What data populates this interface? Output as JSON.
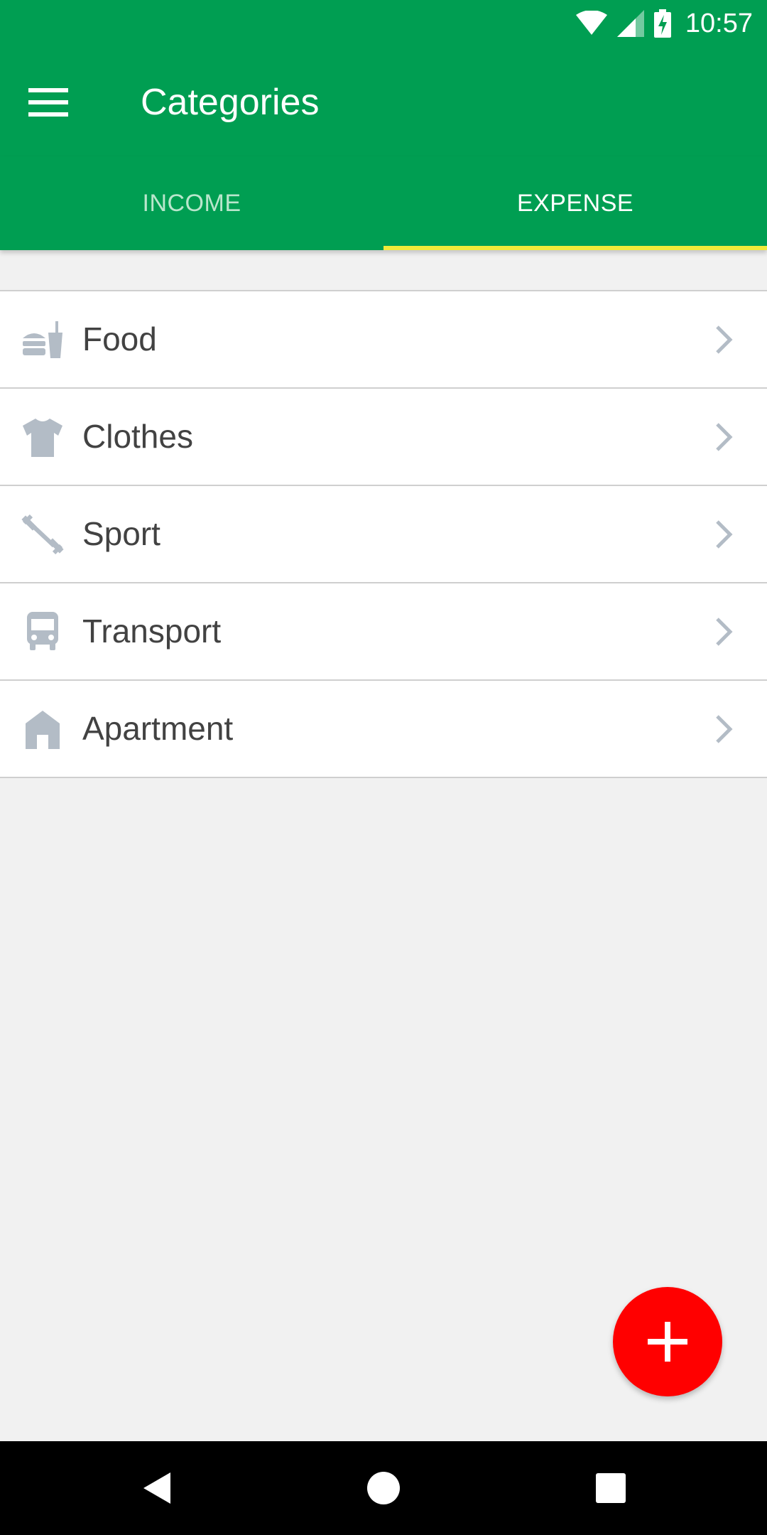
{
  "status_bar": {
    "time": "10:57",
    "icons": [
      "wifi-icon",
      "signal-icon",
      "battery-charging-icon"
    ]
  },
  "app_bar": {
    "title": "Categories",
    "menu_icon": "hamburger-menu-icon"
  },
  "tabs": [
    {
      "label": "INCOME",
      "active": false
    },
    {
      "label": "EXPENSE",
      "active": true
    }
  ],
  "categories": [
    {
      "label": "Food",
      "icon": "food-drink-icon"
    },
    {
      "label": "Clothes",
      "icon": "tshirt-icon"
    },
    {
      "label": "Sport",
      "icon": "dumbbell-icon"
    },
    {
      "label": "Transport",
      "icon": "bus-icon"
    },
    {
      "label": "Apartment",
      "icon": "house-icon"
    }
  ],
  "fab": {
    "icon": "plus-icon"
  },
  "nav_bar": {
    "icons": [
      "back-icon",
      "home-icon",
      "recents-icon"
    ]
  },
  "colors": {
    "primary": "#009e52",
    "tab_indicator": "#f2ea3a",
    "fab": "#ff0000",
    "icon_gray": "#b3bcc6",
    "background": "#f1f1f1"
  }
}
